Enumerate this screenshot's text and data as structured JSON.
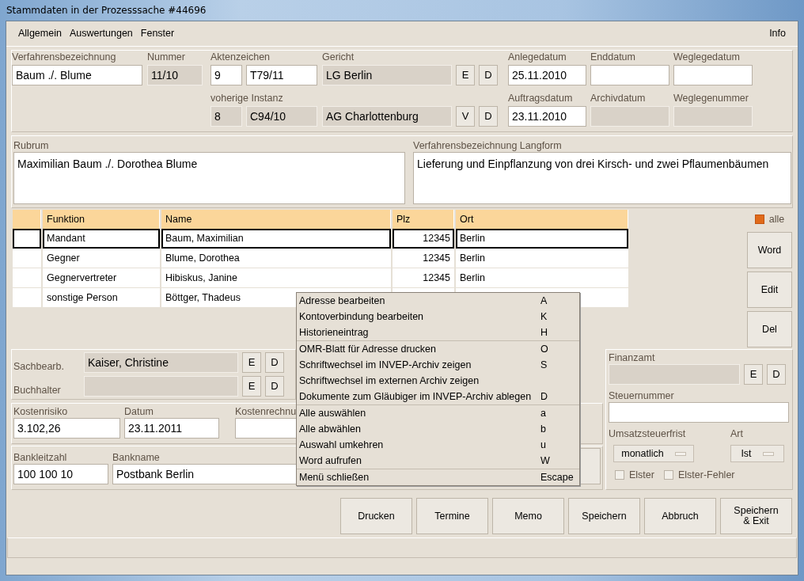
{
  "window": {
    "title": "Stammdaten in der Prozesssache #44696"
  },
  "menu_bar": {
    "items": [
      "Allgemein",
      "Auswertungen",
      "Fenster"
    ],
    "right": "Info"
  },
  "case": {
    "verfahrensbezeichnung": {
      "label": "Verfahrensbezeichnung",
      "value": "Baum ./. Blume",
      "editable": true
    },
    "nummer": {
      "label": "Nummer",
      "value": "11/10",
      "editable": false
    },
    "aktenzeichen": {
      "label": "Aktenzeichen",
      "values": [
        "9",
        "T79/11"
      ],
      "editable": true
    },
    "gericht": {
      "label": "Gericht",
      "value": "LG Berlin",
      "editable": false,
      "buttons": [
        "E",
        "D"
      ]
    },
    "vorherige_instanz": {
      "label": "voherige Instanz",
      "values": [
        "8",
        "C94/10"
      ],
      "editable": false
    },
    "vorheriges_gericht": {
      "value": "AG Charlottenburg",
      "editable": false,
      "buttons": [
        "V",
        "D"
      ]
    },
    "dates": [
      {
        "label": "Anlegedatum",
        "value": "25.11.2010",
        "editable": true
      },
      {
        "label": "Enddatum",
        "editable": true
      },
      {
        "label": "Weglegedatum",
        "editable": true
      },
      {
        "label": "Auftragsdatum",
        "value": "23.11.2010",
        "editable": true
      },
      {
        "label": "Archivdatum",
        "editable": false
      },
      {
        "label": "Weglegenummer",
        "editable": false
      }
    ]
  },
  "rubrum": {
    "label": "Rubrum",
    "value": "Maximilian Baum ./. Dorothea Blume"
  },
  "langform": {
    "label": "Verfahrensbezeichnung Langform",
    "value": "Lieferung und Einpflanzung von drei Kirsch- und zwei Pflaumenbäumen"
  },
  "parties": {
    "columns": [
      "Funktion",
      "Name",
      "Plz",
      "Ort"
    ],
    "rows": [
      {
        "funktion": "Mandant",
        "name": "Baum, Maximilian",
        "plz": "12345",
        "ort": "Berlin",
        "selected": true
      },
      {
        "funktion": "Gegner",
        "name": "Blume, Dorothea",
        "plz": "12345",
        "ort": "Berlin",
        "selected": false
      },
      {
        "funktion": "Gegnervertreter",
        "name": "Hibiskus, Janine",
        "plz": "12345",
        "ort": "Berlin",
        "selected": false
      },
      {
        "funktion": "sonstige Person",
        "name": "Böttger, Thadeus",
        "selected": false
      }
    ],
    "select_all": {
      "label": "alle",
      "checked": true
    },
    "buttons": [
      {
        "label": "Word"
      },
      {
        "label": "Edit"
      },
      {
        "label": "Del"
      }
    ]
  },
  "staff": [
    {
      "label": "Sachbearb.",
      "value": "Kaiser, Christine",
      "buttons": [
        "E",
        "D"
      ]
    },
    {
      "label": "Buchhalter",
      "buttons": [
        "E",
        "D"
      ]
    }
  ],
  "costs": [
    {
      "label": "Kostenrisiko",
      "value": "3.102,26"
    },
    {
      "label": "Datum",
      "value": "23.11.2011"
    },
    {
      "label": "Kostenrechnu"
    }
  ],
  "bank": [
    {
      "label": "Bankleitzahl",
      "value": "100 100 10"
    },
    {
      "label": "Bankname",
      "value": "Postbank Berlin"
    }
  ],
  "tax": {
    "finanzamt": {
      "label": "Finanzamt",
      "buttons": [
        "E",
        "D"
      ]
    },
    "steuernummer": {
      "label": "Steuernummer"
    },
    "umsatzsteuerfrist": {
      "label": "Umsatzsteuerfrist",
      "value": "monatlich"
    },
    "art": {
      "label": "Art",
      "value": "Ist"
    },
    "checks": [
      {
        "label": "Elster",
        "checked": false
      },
      {
        "label": "Elster-Fehler",
        "checked": false
      }
    ]
  },
  "actions": [
    {
      "label": "Drucken"
    },
    {
      "label": "Termine"
    },
    {
      "label": "Memo"
    },
    {
      "label": "Speichern"
    },
    {
      "label": "Abbruch"
    },
    {
      "label": "Speichern\n& Exit"
    }
  ],
  "context_menu": {
    "sections": [
      [
        {
          "label": "Adresse bearbeiten",
          "shortcut": "A"
        },
        {
          "label": "Kontoverbindung bearbeiten",
          "shortcut": "K"
        },
        {
          "label": "Historieneintrag",
          "shortcut": "H"
        }
      ],
      [
        {
          "label": "OMR-Blatt für Adresse drucken",
          "shortcut": "O"
        },
        {
          "label": "Schriftwechsel im INVEP-Archiv zeigen",
          "shortcut": "S"
        },
        {
          "label": "Schriftwechsel im externen Archiv zeigen"
        },
        {
          "label": "Dokumente zum Gläubiger im INVEP-Archiv ablegen",
          "shortcut": "D"
        }
      ],
      [
        {
          "label": "Alle auswählen",
          "shortcut": "a"
        },
        {
          "label": "Alle abwählen",
          "shortcut": "b"
        },
        {
          "label": "Auswahl umkehren",
          "shortcut": "u"
        },
        {
          "label": "Word aufrufen",
          "shortcut": "W"
        }
      ],
      [
        {
          "label": "Menü schließen",
          "shortcut": "Escape"
        }
      ]
    ]
  }
}
